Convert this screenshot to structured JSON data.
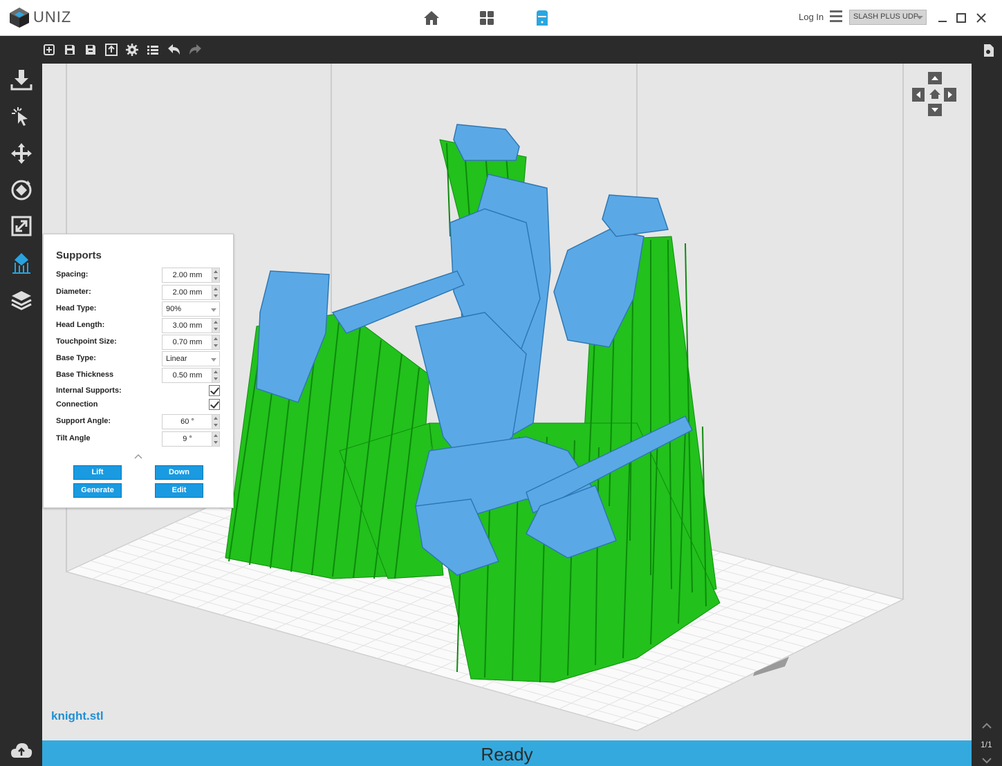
{
  "app": {
    "logo_text": "UNIZ"
  },
  "header": {
    "login_label": "Log In",
    "printer": "SLASH PLUS UDP"
  },
  "panel": {
    "title": "Supports",
    "spacing_label": "Spacing:",
    "spacing_value": "2.00 mm",
    "diameter_label": "Diameter:",
    "diameter_value": "2.00 mm",
    "head_type_label": "Head Type:",
    "head_type_value": "90%",
    "head_length_label": "Head Length:",
    "head_length_value": "3.00 mm",
    "touchpoint_label": "Touchpoint Size:",
    "touchpoint_value": "0.70 mm",
    "base_type_label": "Base Type:",
    "base_type_value": "Linear",
    "base_thickness_label": "Base Thickness",
    "base_thickness_value": "0.50 mm",
    "internal_supports_label": "Internal Supports:",
    "internal_supports_checked": true,
    "connection_label": "Connection",
    "connection_checked": true,
    "support_angle_label": "Support Angle:",
    "support_angle_value": "60 °",
    "tilt_angle_label": "Tilt Angle",
    "tilt_angle_value": "9 °",
    "lift_label": "Lift",
    "down_label": "Down",
    "generate_label": "Generate",
    "edit_label": "Edit"
  },
  "viewport": {
    "filename": "knight.stl"
  },
  "status": {
    "text": "Ready"
  },
  "pager": {
    "text": "1/1"
  },
  "colors": {
    "accent": "#34a9de",
    "support_green": "#22c11c",
    "model_blue": "#5aa9e6"
  }
}
